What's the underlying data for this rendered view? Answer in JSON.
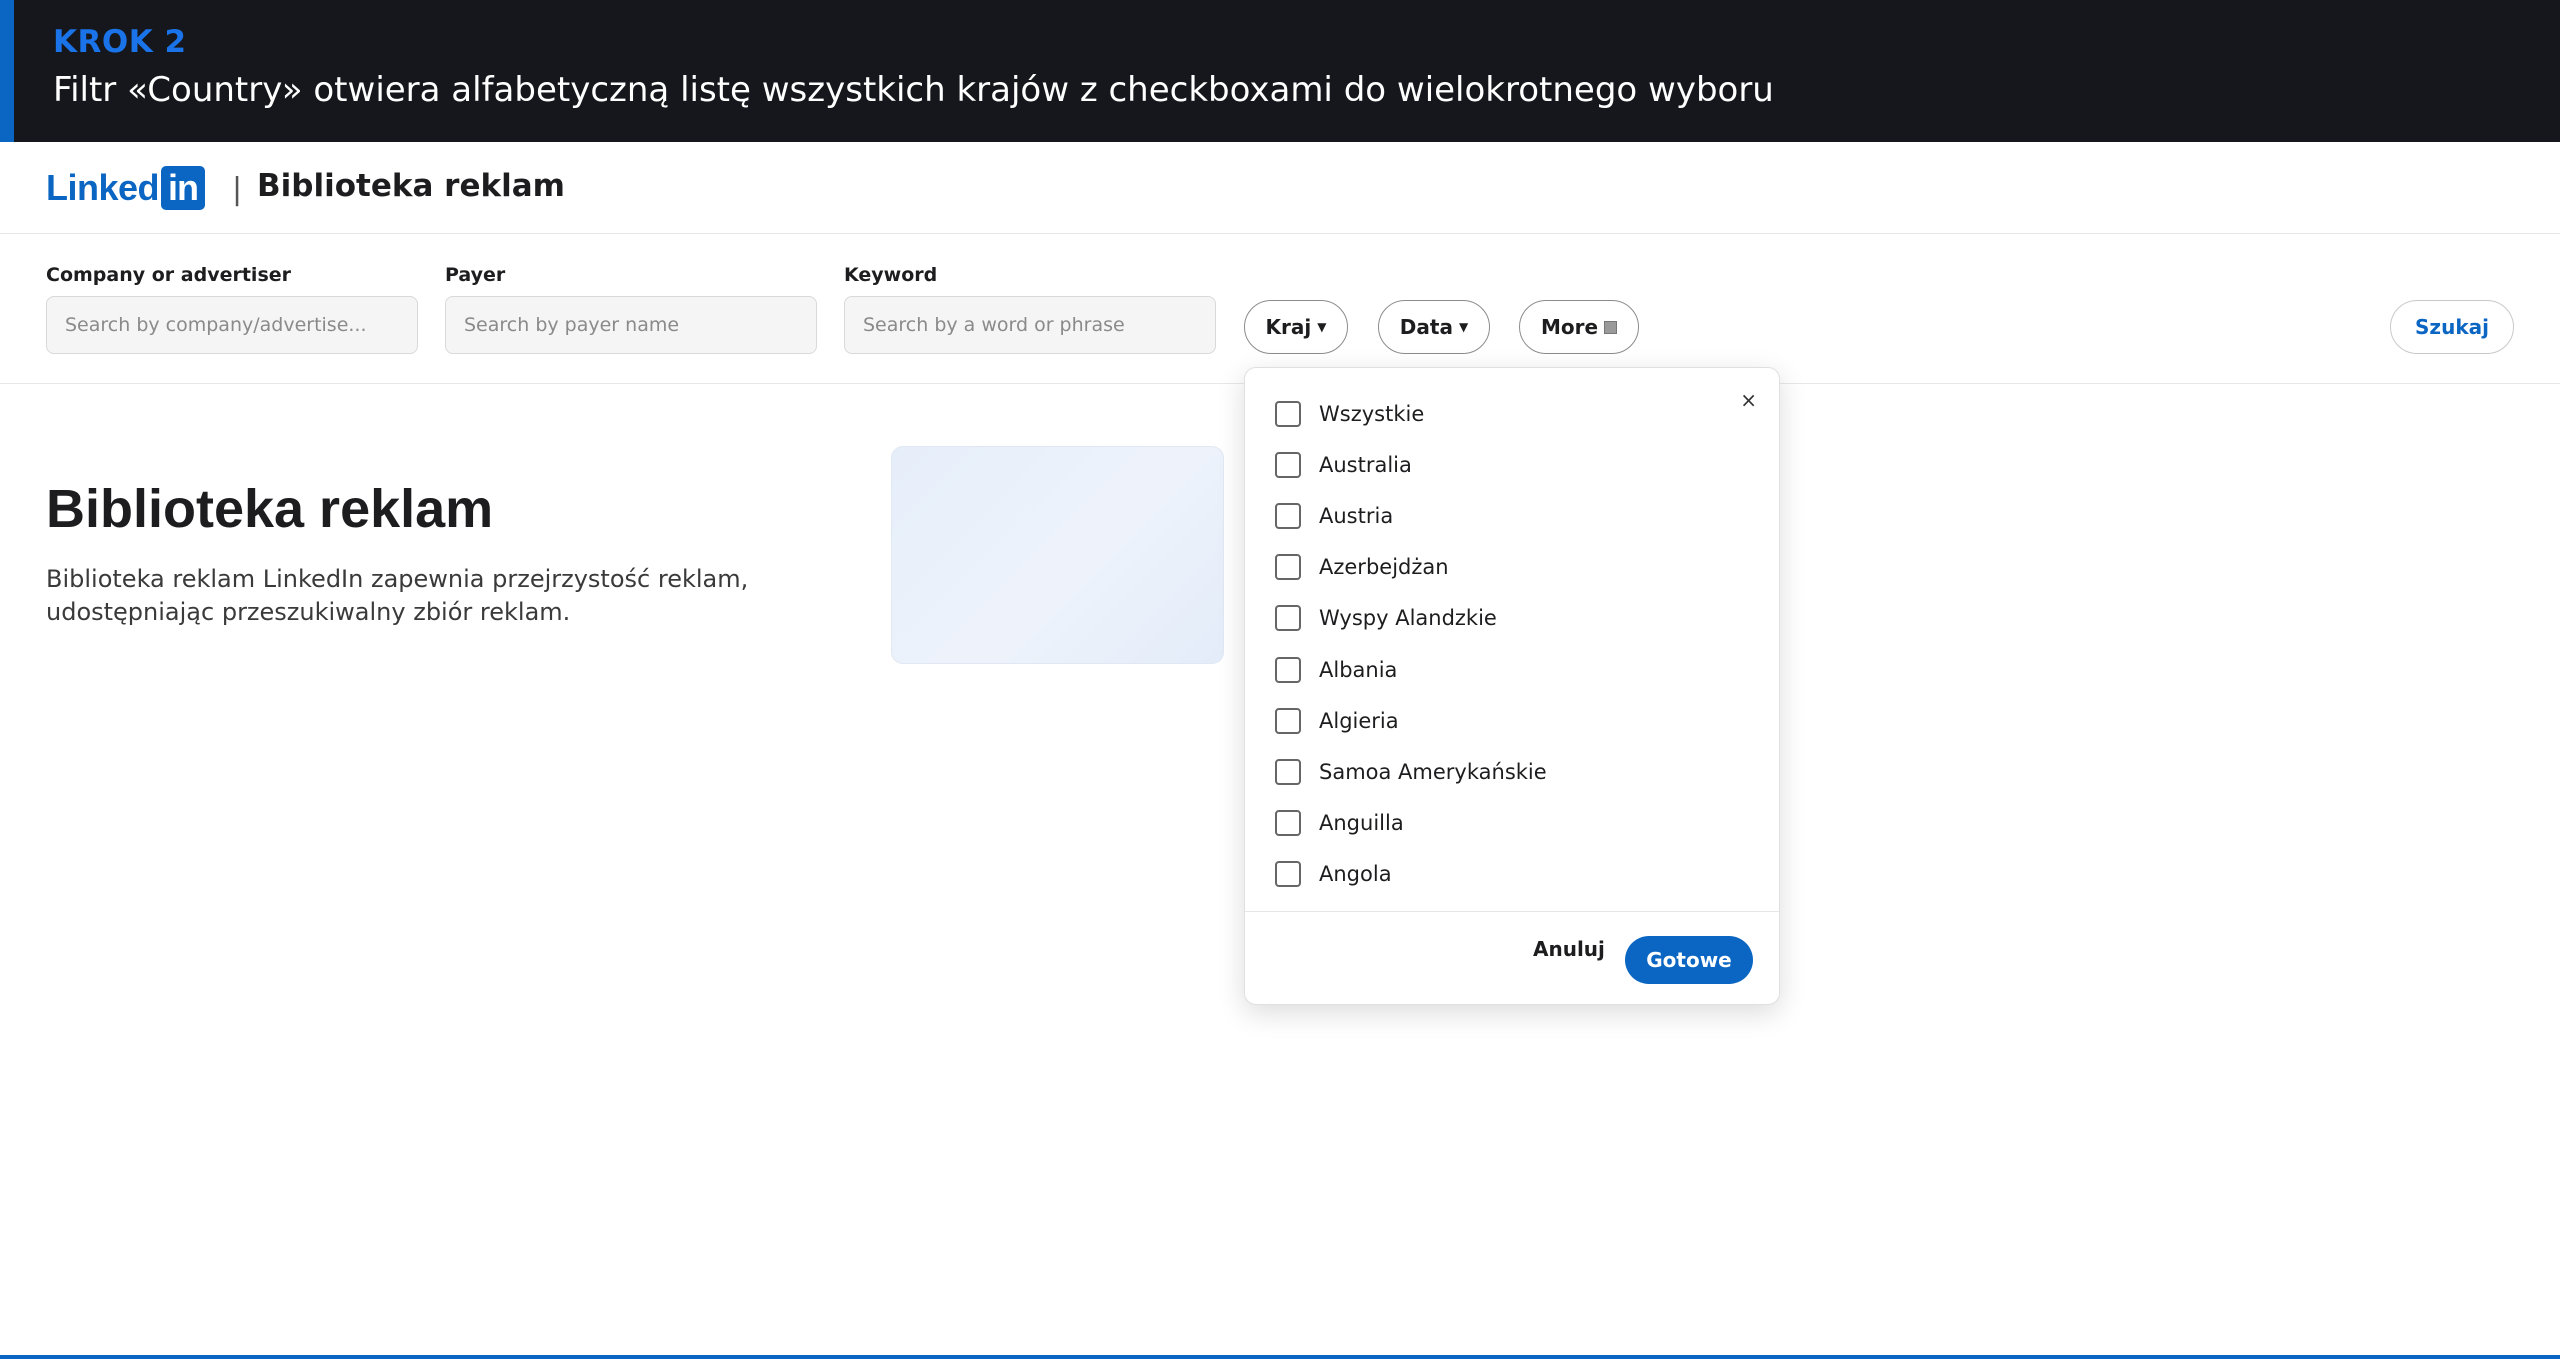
{
  "banner": {
    "step": "KROK 2",
    "text": "Filtr «Country» otwiera alfabetyczną listę wszystkich krajów z checkboxami do wielokrotnego wyboru"
  },
  "header": {
    "logo_word": "Linked",
    "logo_box": "in",
    "separator": "|",
    "title": "Biblioteka reklam"
  },
  "filters": {
    "company": {
      "label": "Company or advertiser",
      "placeholder": "Search by company/advertise..."
    },
    "payer": {
      "label": "Payer",
      "placeholder": "Search by payer name"
    },
    "keyword": {
      "label": "Keyword",
      "placeholder": "Search by a word or phrase"
    },
    "country_label": "Kraj",
    "date_label": "Data",
    "more_label": "More",
    "search_label": "Szukaj"
  },
  "hero": {
    "title": "Biblioteka reklam",
    "description": "Biblioteka reklam LinkedIn zapewnia przejrzystość reklam, udostępniając przeszukiwalny zbiór reklam."
  },
  "country_dropdown": {
    "close_label": "×",
    "options": [
      {
        "label": "Wszystkie",
        "checked": false
      },
      {
        "label": "Australia",
        "checked": false
      },
      {
        "label": "Austria",
        "checked": false
      },
      {
        "label": "Azerbejdżan",
        "checked": false
      },
      {
        "label": "Wyspy Alandzkie",
        "checked": false
      },
      {
        "label": "Albania",
        "checked": false
      },
      {
        "label": "Algieria",
        "checked": false
      },
      {
        "label": "Samoa Amerykańskie",
        "checked": false
      },
      {
        "label": "Anguilla",
        "checked": false
      },
      {
        "label": "Angola",
        "checked": false
      }
    ],
    "cancel_label": "Anuluj",
    "done_label": "Gotowe"
  },
  "colors": {
    "brand": "#0a66c2",
    "banner_bg": "#16171c",
    "step_accent": "#1a73e8"
  }
}
